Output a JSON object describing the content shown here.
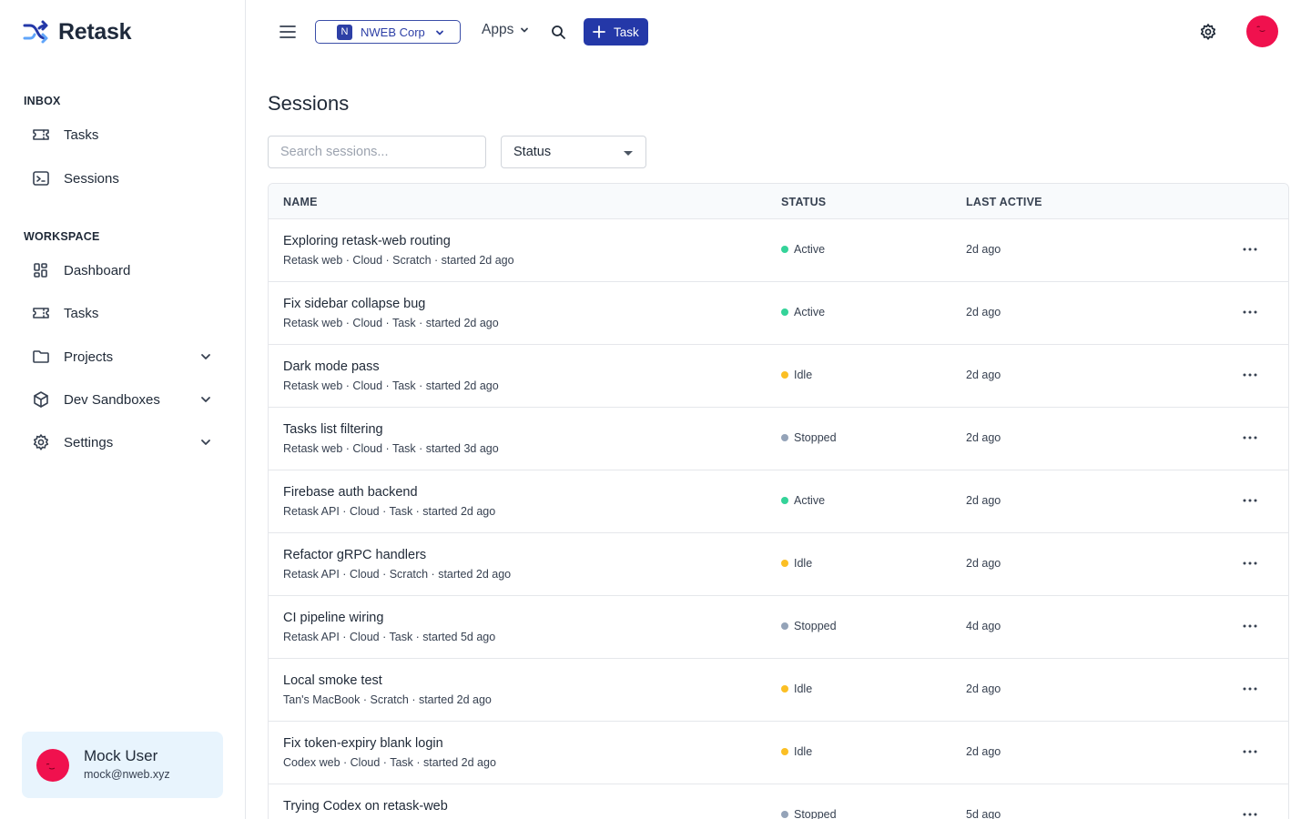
{
  "app": {
    "name": "Retask"
  },
  "sidebar": {
    "inbox_label": "INBOX",
    "inbox_items": [
      {
        "label": "Tasks",
        "icon": "ticket-icon"
      },
      {
        "label": "Sessions",
        "icon": "terminal-icon"
      }
    ],
    "workspace_label": "WORKSPACE",
    "workspace_items": [
      {
        "label": "Dashboard",
        "icon": "dashboard-icon"
      },
      {
        "label": "Tasks",
        "icon": "ticket-icon"
      },
      {
        "label": "Projects",
        "icon": "folder-icon",
        "expandable": true
      },
      {
        "label": "Dev Sandboxes",
        "icon": "cube-icon",
        "expandable": true
      },
      {
        "label": "Settings",
        "icon": "gear-icon",
        "expandable": true
      }
    ],
    "user": {
      "name": "Mock User",
      "email": "mock@nweb.xyz"
    }
  },
  "header": {
    "org_initial": "N",
    "org_name": "NWEB Corp",
    "apps_label": "Apps",
    "task_button_label": "Task"
  },
  "main": {
    "title": "Sessions",
    "search_placeholder": "Search sessions...",
    "status_filter_label": "Status",
    "columns": {
      "name": "NAME",
      "status": "STATUS",
      "last_active": "LAST ACTIVE"
    },
    "rows": [
      {
        "name": "Exploring retask-web routing",
        "meta": "Retask web · Cloud · Scratch · started 2d ago",
        "status": "Active",
        "last_active": "2d ago"
      },
      {
        "name": "Fix sidebar collapse bug",
        "meta": "Retask web · Cloud · Task · started 2d ago",
        "status": "Active",
        "last_active": "2d ago"
      },
      {
        "name": "Dark mode pass",
        "meta": "Retask web · Cloud · Task · started 2d ago",
        "status": "Idle",
        "last_active": "2d ago"
      },
      {
        "name": "Tasks list filtering",
        "meta": "Retask web · Cloud · Task · started 3d ago",
        "status": "Stopped",
        "last_active": "2d ago"
      },
      {
        "name": "Firebase auth backend",
        "meta": "Retask API · Cloud · Task · started 2d ago",
        "status": "Active",
        "last_active": "2d ago"
      },
      {
        "name": "Refactor gRPC handlers",
        "meta": "Retask API · Cloud · Scratch · started 2d ago",
        "status": "Idle",
        "last_active": "2d ago"
      },
      {
        "name": "CI pipeline wiring",
        "meta": "Retask API · Cloud · Task · started 5d ago",
        "status": "Stopped",
        "last_active": "4d ago"
      },
      {
        "name": "Local smoke test",
        "meta": "Tan's MacBook · Scratch · started 2d ago",
        "status": "Idle",
        "last_active": "2d ago"
      },
      {
        "name": "Fix token-expiry blank login",
        "meta": "Codex web · Cloud · Task · started 2d ago",
        "status": "Idle",
        "last_active": "2d ago"
      },
      {
        "name": "Trying Codex on retask-web",
        "meta": "",
        "status": "Stopped",
        "last_active": "5d ago"
      }
    ]
  },
  "colors": {
    "brand": "#2438a8",
    "avatar": "#f0114e",
    "status_active": "#34d399",
    "status_idle": "#fbbf24",
    "status_stopped": "#94a3b8",
    "user_card_bg": "#e8f4fd"
  }
}
